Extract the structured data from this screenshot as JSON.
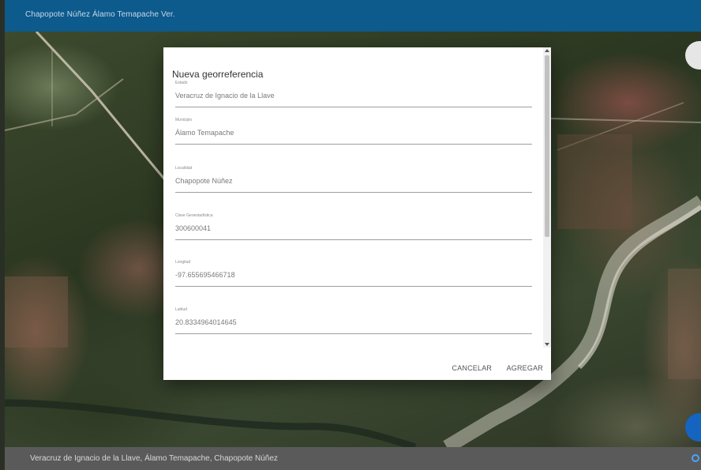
{
  "appbar": {
    "title": "Chapopote Núñez Álamo Temapache Ver."
  },
  "dialog": {
    "title": "Nueva georreferencia",
    "fields": [
      {
        "label": "Estado",
        "value": "Veracruz de Ignacio de la Llave"
      },
      {
        "label": "Municipio",
        "value": "Álamo Temapache"
      },
      {
        "label": "Localidad",
        "value": "Chapopote Núñez"
      },
      {
        "label": "Clave Geoestadística",
        "value": "300600041"
      },
      {
        "label": "Longitud",
        "value": "-97.655695466718"
      },
      {
        "label": "Latitud",
        "value": "20.8334964014645"
      }
    ],
    "actions": {
      "cancel": "CANCELAR",
      "add": "AGREGAR"
    }
  },
  "statusbar": {
    "text": "Veracruz de Ignacio de la Llave, Álamo Temapache, Chapopote Núñez"
  },
  "icons": {
    "location": "location-icon"
  },
  "colors": {
    "appbar": "#0d5a8c",
    "statusbar": "#5a5a5a",
    "fab": "#1565c0"
  }
}
